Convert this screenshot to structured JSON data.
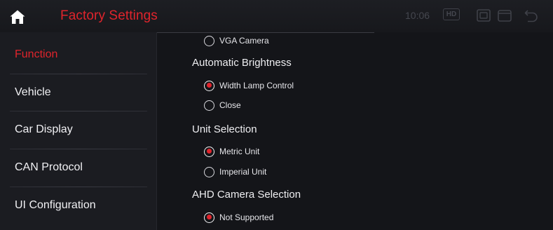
{
  "header": {
    "title": "Factory Settings",
    "home_icon": "home-icon",
    "time": "10:06",
    "hd_badge": "HD",
    "icons": [
      "screen-mirror-icon",
      "window-icon",
      "back-icon"
    ]
  },
  "colors": {
    "accent": "#e0242c",
    "background": "#141519",
    "sidebar": "#1b1c21"
  },
  "sidebar": {
    "items": [
      {
        "label": "Function",
        "active": true
      },
      {
        "label": "Vehicle",
        "active": false
      },
      {
        "label": "Car Display",
        "active": false
      },
      {
        "label": "CAN Protocol",
        "active": false
      },
      {
        "label": "UI Configuration",
        "active": false
      }
    ]
  },
  "content": {
    "partial_option": {
      "label": "VGA Camera",
      "checked": false
    },
    "sections": [
      {
        "title": "Automatic Brightness",
        "options": [
          {
            "label": "Width Lamp Control",
            "checked": true
          },
          {
            "label": "Close",
            "checked": false
          }
        ]
      },
      {
        "title": "Unit Selection",
        "options": [
          {
            "label": "Metric Unit",
            "checked": true
          },
          {
            "label": "Imperial Unit",
            "checked": false
          }
        ]
      },
      {
        "title": "AHD Camera Selection",
        "options": [
          {
            "label": "Not Supported",
            "checked": true
          }
        ]
      }
    ]
  }
}
